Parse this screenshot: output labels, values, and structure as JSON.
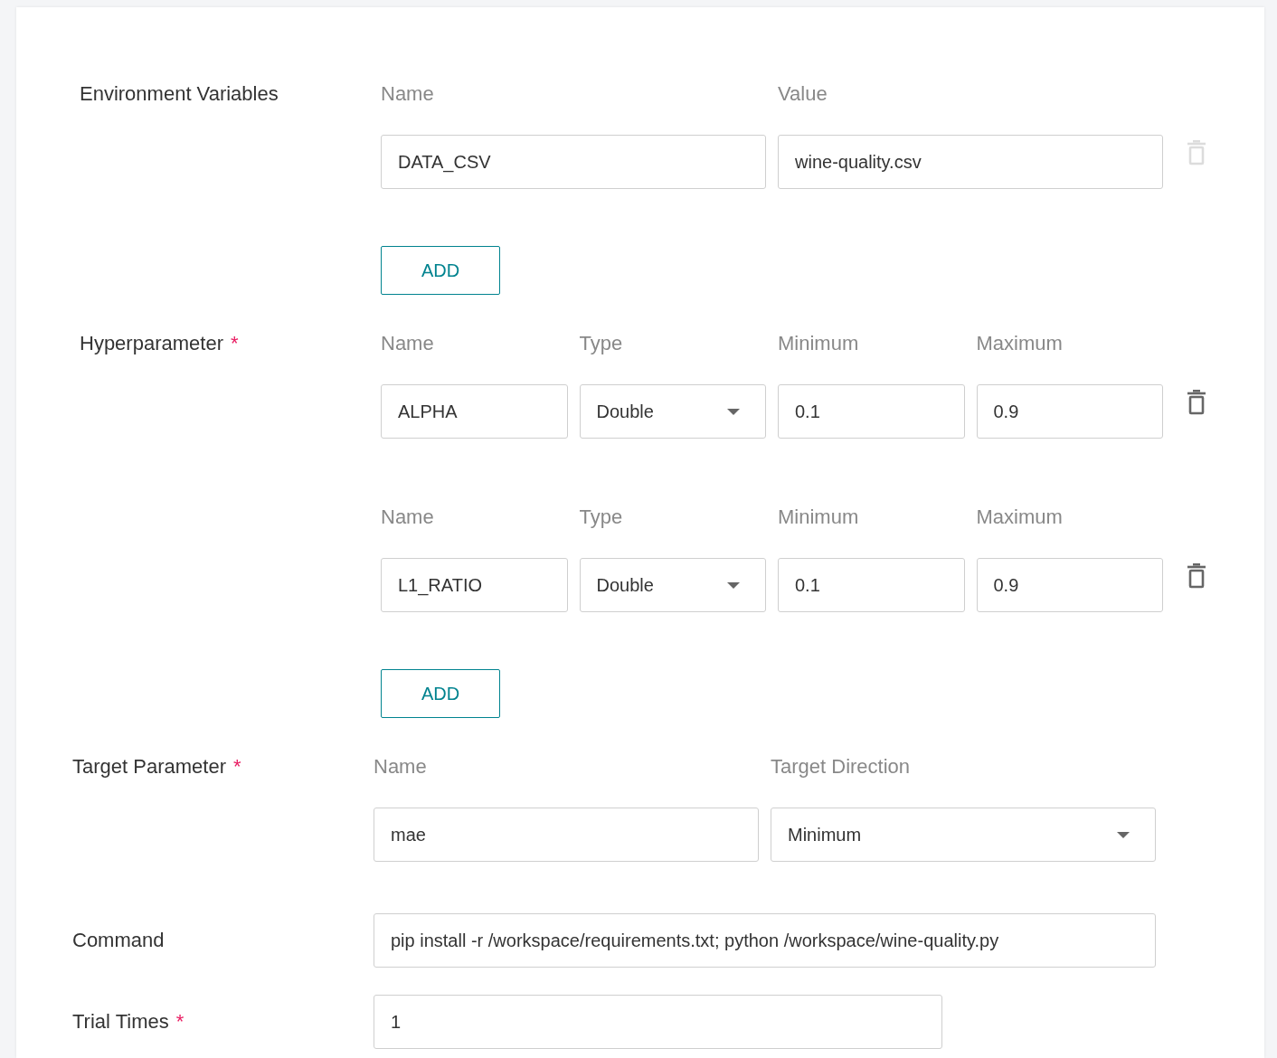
{
  "sections": [
    {
      "kind": "rows",
      "label": "Environment Variables",
      "rows": [
        {
          "fields": [
            {
              "kind": "text",
              "header": "Name",
              "value": "DATA_CSV"
            },
            {
              "kind": "text",
              "header": "Value",
              "value": "wine-quality.csv"
            }
          ],
          "delete": {
            "disabled": true
          }
        }
      ],
      "add_button": "ADD"
    },
    {
      "kind": "rows",
      "label": "Hyperparameter",
      "required_mark": "*",
      "rows": [
        {
          "fields": [
            {
              "kind": "text",
              "header": "Name",
              "value": "ALPHA"
            },
            {
              "kind": "select",
              "header": "Type",
              "value": "Double"
            },
            {
              "kind": "text",
              "header": "Minimum",
              "value": "0.1"
            },
            {
              "kind": "text",
              "header": "Maximum",
              "value": "0.9"
            }
          ],
          "delete": {
            "disabled": false
          }
        },
        {
          "fields": [
            {
              "kind": "text",
              "header": "Name",
              "value": "L1_RATIO"
            },
            {
              "kind": "select",
              "header": "Type",
              "value": "Double"
            },
            {
              "kind": "text",
              "header": "Minimum",
              "value": "0.1"
            },
            {
              "kind": "text",
              "header": "Maximum",
              "value": "0.9"
            }
          ],
          "delete": {
            "disabled": false
          }
        }
      ],
      "add_button": "ADD"
    },
    {
      "kind": "rows",
      "label": "Target Parameter",
      "required_mark": "*",
      "rows": [
        {
          "fields": [
            {
              "kind": "text",
              "header": "Name",
              "value": "mae"
            },
            {
              "kind": "select",
              "header": "Target Direction",
              "value": "Minimum"
            }
          ]
        }
      ]
    },
    {
      "kind": "field",
      "label": "Command",
      "value": "pip install -r /workspace/requirements.txt; python /workspace/wine-quality.py"
    },
    {
      "kind": "number",
      "label": "Trial Times",
      "required_mark": "*",
      "value": "1"
    }
  ]
}
